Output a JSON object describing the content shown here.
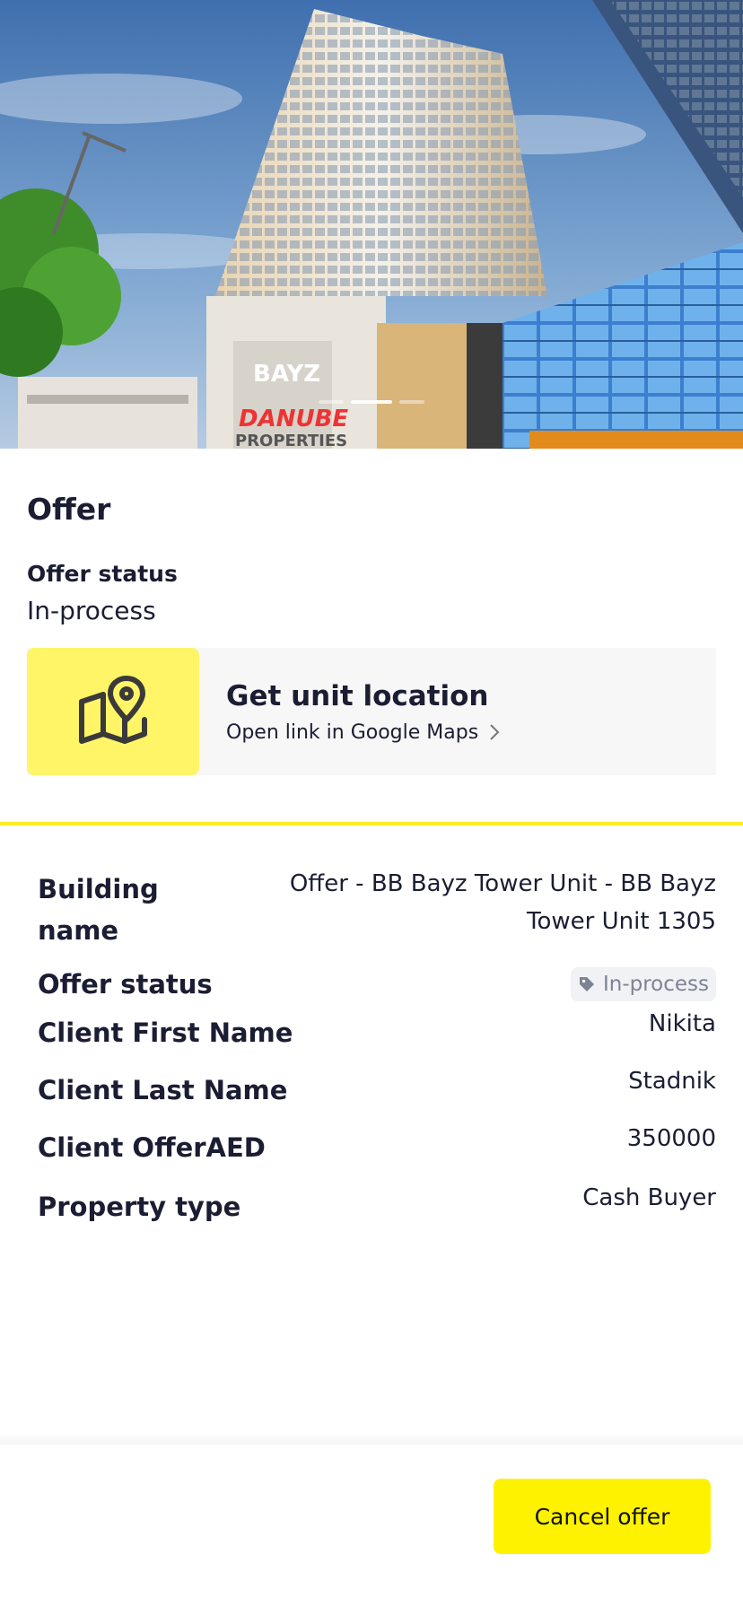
{
  "hero": {
    "slides": 3,
    "active_slide": 1
  },
  "offer": {
    "title": "Offer",
    "status_label": "Offer status",
    "status_value": "In-process"
  },
  "location": {
    "title": "Get unit location",
    "subtitle": "Open link in Google Maps",
    "icon": "map-pin-icon"
  },
  "details": {
    "building_label": "Building name",
    "building_value": "Offer - BB Bayz Tower Unit - BB Bayz Tower Unit 1305",
    "status_label": "Offer status",
    "status_value": "In-process",
    "first_name_label": "Client First Name",
    "first_name_value": "Nikita",
    "last_name_label": "Client Last Name",
    "last_name_value": "Stadnik",
    "client_offer_label": "Client OfferAED",
    "client_offer_value": "350000",
    "property_type_label": "Property type",
    "property_type_value": "Cash Buyer"
  },
  "footer": {
    "cancel_label": "Cancel offer"
  },
  "colors": {
    "accent_yellow": "#fff200",
    "icon_box_yellow": "#fff566",
    "text_dark": "#1b1d33"
  }
}
